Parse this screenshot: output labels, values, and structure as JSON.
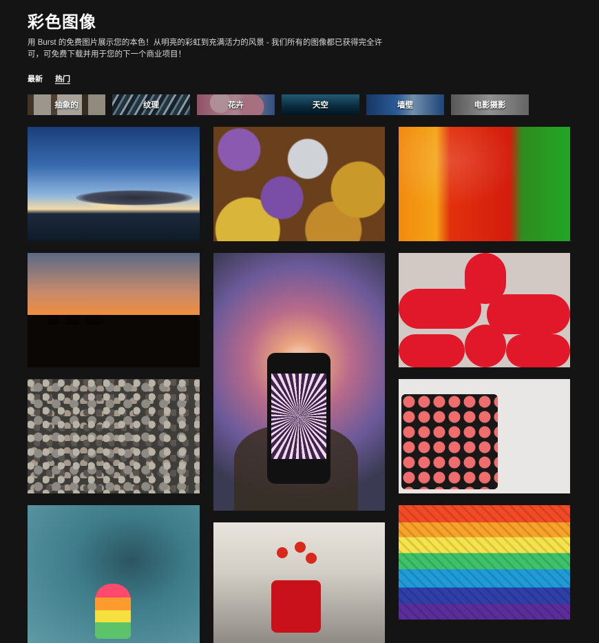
{
  "page": {
    "title": "彩色图像",
    "description": "用 Burst 的免费图片展示您的本色！从明亮的彩虹到充满活力的风景 - 我们所有的图像都已获得完全许可，可免费下载并用于您的下一个商业项目！"
  },
  "sort": {
    "latest": "最新",
    "popular": "热门",
    "active": "popular"
  },
  "categories": [
    "抽象的",
    "纹理",
    "花卉",
    "天空",
    "墙壁",
    "电影摄影"
  ],
  "photos": [
    "sunset-over-sea",
    "orange-city-sunset",
    "pebbles",
    "popsicle",
    "chrysanthemums",
    "phone-bokeh",
    "red-flowers-vase",
    "bell-peppers",
    "red-lipsticks",
    "eyeshadow-palette",
    "rainbow-weave"
  ]
}
